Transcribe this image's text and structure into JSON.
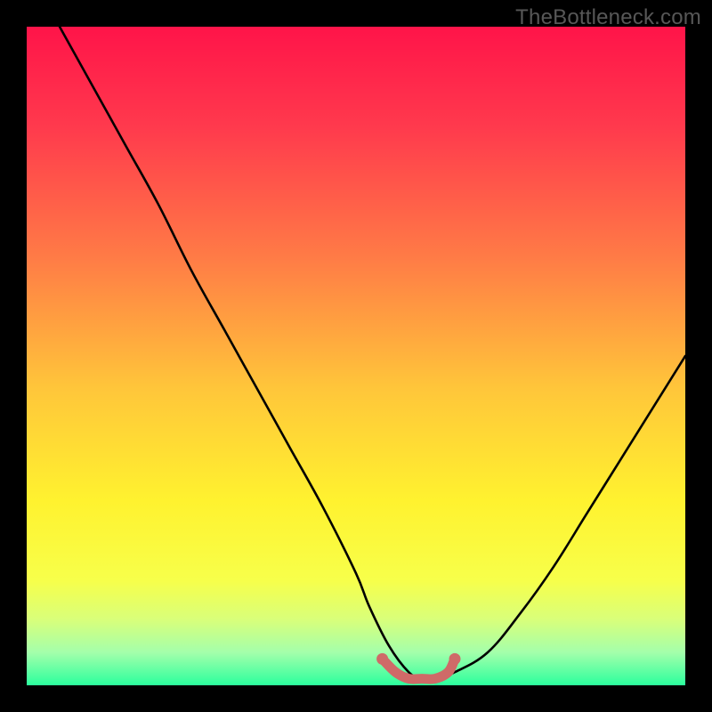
{
  "watermark": "TheBottleneck.com",
  "colors": {
    "frame": "#000000",
    "gradient_stops": [
      {
        "offset": 0.0,
        "color": "#ff1449"
      },
      {
        "offset": 0.15,
        "color": "#ff394d"
      },
      {
        "offset": 0.35,
        "color": "#ff7b46"
      },
      {
        "offset": 0.55,
        "color": "#ffc63a"
      },
      {
        "offset": 0.72,
        "color": "#fff22f"
      },
      {
        "offset": 0.84,
        "color": "#f7ff4a"
      },
      {
        "offset": 0.9,
        "color": "#d9ff7a"
      },
      {
        "offset": 0.95,
        "color": "#a4ffab"
      },
      {
        "offset": 1.0,
        "color": "#2bff9d"
      }
    ],
    "curve": "#000000",
    "flat_segment": "#cf6a68"
  },
  "chart_data": {
    "type": "line",
    "title": "",
    "xlabel": "",
    "ylabel": "",
    "xlim": [
      0,
      100
    ],
    "ylim": [
      0,
      100
    ],
    "series": [
      {
        "name": "bottleneck-curve",
        "x": [
          5,
          10,
          15,
          20,
          25,
          30,
          35,
          40,
          45,
          50,
          52,
          55,
          58,
          60,
          62,
          65,
          70,
          75,
          80,
          85,
          90,
          95,
          100
        ],
        "y": [
          100,
          91,
          82,
          73,
          63,
          54,
          45,
          36,
          27,
          17,
          12,
          6,
          2,
          1,
          1,
          2,
          5,
          11,
          18,
          26,
          34,
          42,
          50
        ]
      },
      {
        "name": "flat-zone",
        "x": [
          54,
          56,
          58,
          60,
          62,
          64,
          65
        ],
        "y": [
          4,
          2,
          1,
          1,
          1,
          2,
          4
        ]
      }
    ],
    "annotations": []
  }
}
